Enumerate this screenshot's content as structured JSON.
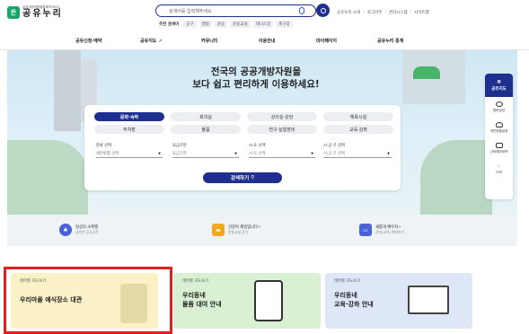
{
  "header": {
    "logo_sub": "공공개방자원통합예약서비스",
    "logo_main": "공유누리",
    "search_placeholder": "검색어를 입력해주세요",
    "popular_label": "추천 검색어",
    "popular_tags": [
      "공구",
      "캠핑",
      "운동",
      "운동교실",
      "테니스장",
      "축구장"
    ],
    "top_menu": [
      "공유누리 소개",
      "로그아웃",
      "관리시스템",
      "사이트맵"
    ]
  },
  "nav": {
    "items": [
      "공유신청·예약",
      "공유지도",
      "커뮤니티",
      "이용안내",
      "마이페이지",
      "공유누리 통계"
    ]
  },
  "hero": {
    "title_line1": "전국의 공공개방자원을",
    "title_line2": "보다 쉽고 편리하게 이용하세요!"
  },
  "search_panel": {
    "categories": [
      {
        "label": "문화·숙박",
        "selected": true
      },
      {
        "label": "회의실",
        "selected": false
      },
      {
        "label": "강의실·강당",
        "selected": false
      },
      {
        "label": "체육시설",
        "selected": false
      },
      {
        "label": "주차장",
        "selected": false
      },
      {
        "label": "물품",
        "selected": false
      },
      {
        "label": "연구·실험장비",
        "selected": false
      },
      {
        "label": "교육·강좌",
        "selected": false
      }
    ],
    "filters": [
      {
        "label": "분류 선택",
        "value": "세분류를 선택"
      },
      {
        "label": "요금구분",
        "value": "요금구분"
      },
      {
        "label": "시·도 선택",
        "value": "시·도 선택"
      },
      {
        "label": "시·군·구 선택",
        "value": "시·군·구 선택"
      }
    ],
    "search_button": "검색하기"
  },
  "quick_menu": {
    "title": "공유지도",
    "items": [
      "챗봇상담",
      "개인맞춤설정",
      "나의예약내역",
      "TOP"
    ]
  },
  "info_bar": [
    {
      "title": "일상의 소확행",
      "sub": "내주변 공유공간",
      "color": "#4a62d8"
    },
    {
      "title": "건강이 제일입니다~",
      "sub": "운동시설 찾기",
      "color": "#f2a81d"
    },
    {
      "title": "새롭게 배우자~",
      "sub": "강좌(교육) 예약하기",
      "color": "#4a62d8"
    }
  ],
  "theme_cards": [
    {
      "small": "테마별 지도보기",
      "title": "우리마을 예식장소 대관",
      "bg": "#fbf1c7"
    },
    {
      "small": "테마별 지도보기",
      "title_line1": "우리동네",
      "title_line2": "물품 대여 안내",
      "bg": "#d9f0d2"
    },
    {
      "small": "테마별 지도보기",
      "title_line1": "우리동네",
      "title_line2": "교육·강좌 안내",
      "bg": "#dde7f7"
    }
  ],
  "colors": {
    "primary": "#1e2f8f",
    "brand": "#1aa36b",
    "highlight": "#e02020"
  }
}
